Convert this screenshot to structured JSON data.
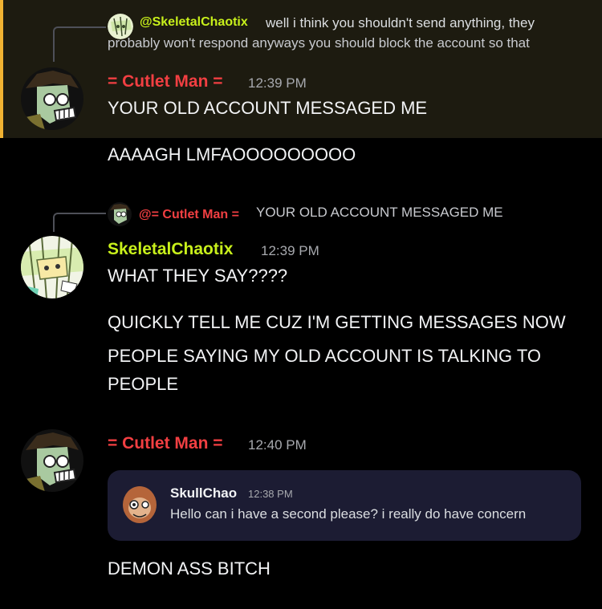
{
  "messages": [
    {
      "reply_to": {
        "author": "@SkeletalChaotix",
        "text_line1": "well i think you shouldn't send anything, they",
        "text_line2": "probably won't respond anyways you should block the account so that"
      },
      "author": "= Cutlet Man =",
      "timestamp": "12:39 PM",
      "lines": [
        "YOUR OLD ACCOUNT MESSAGED ME"
      ],
      "highlighted": true
    },
    {
      "lines": [
        "AAAAGH LMFAOOOOOOOOO"
      ]
    },
    {
      "reply_to": {
        "author": "@= Cutlet Man =",
        "text": "YOUR OLD ACCOUNT MESSAGED ME"
      },
      "author": "SkeletalChaotix",
      "timestamp": "12:39 PM",
      "lines": [
        "WHAT THEY SAY????",
        "QUICKLY TELL ME CUZ I'M GETTING MESSAGES NOW",
        "PEOPLE SAYING MY OLD ACCOUNT IS TALKING TO",
        "PEOPLE"
      ]
    },
    {
      "author": "= Cutlet Man =",
      "timestamp": "12:40 PM",
      "forwarded": {
        "author": "SkullChao",
        "timestamp": "12:38 PM",
        "text": "Hello can i have a second please? i really do have concern"
      },
      "lines": [
        "DEMON ASS BITCH"
      ]
    }
  ],
  "colors": {
    "cutlet_name": "#f23f42",
    "skeletal_name": "#c8f01b",
    "mention_highlight_bg": "#1d1b10",
    "mention_highlight_bar": "#f0b232",
    "embed_bg": "#1c1c33"
  }
}
